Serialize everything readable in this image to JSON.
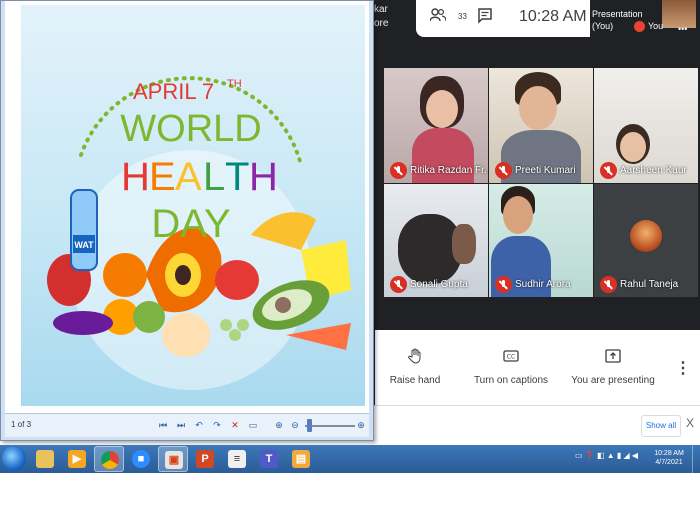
{
  "meet": {
    "cutoff_text_1": "kar",
    "cutoff_text_2": "ore",
    "participants_count": "33",
    "clock": "10:28 AM",
    "presentation_label": "Presentation",
    "presentation_owner": "(You)",
    "presenter_you": "You",
    "participants": [
      {
        "name": "Ritika Razdan Fr..."
      },
      {
        "name": "Preeti Kumari"
      },
      {
        "name": "Aarsheen Kaur"
      },
      {
        "name": "Sonali Gupta"
      },
      {
        "name": "Sudhir Arora"
      },
      {
        "name": "Rahul Taneja"
      }
    ],
    "controls": {
      "raise_hand": "Raise hand",
      "captions": "Turn on captions",
      "presenting": "You are presenting"
    }
  },
  "download_bar": {
    "show_all": "Show all",
    "close": "X"
  },
  "viewer": {
    "page_count": "1 of 3",
    "slide": {
      "line1": "APRIL 7",
      "line1_sup": "TH",
      "line2": "WORLD",
      "line3": [
        "H",
        "E",
        "A",
        "L",
        "T",
        "H"
      ],
      "line4": "DAY",
      "bottle_label": "WAT"
    }
  },
  "taskbar": {
    "clock_time": "10:28 AM",
    "clock_date": "4/7/2021"
  },
  "colors": {
    "meet_bg": "#202124",
    "taskbar": "#2a5c97",
    "mute_red": "#d93025",
    "world_green": "#7cb82f",
    "health_colors": [
      "#e53935",
      "#f57c00",
      "#fbc02d",
      "#43a047",
      "#00897b",
      "#8e24aa"
    ]
  }
}
